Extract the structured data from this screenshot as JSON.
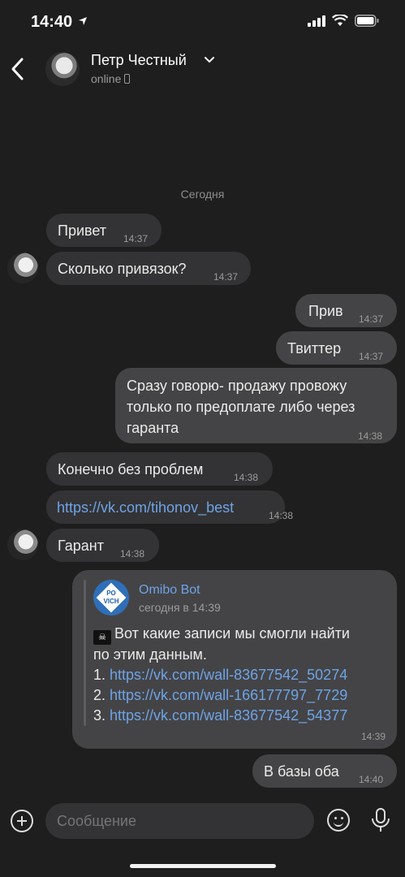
{
  "status_bar": {
    "time": "14:40"
  },
  "header": {
    "name": "Петр Честный",
    "status": "online"
  },
  "date_separator": "Сегодня",
  "messages": [
    {
      "text": "Привет",
      "time": "14:37"
    },
    {
      "text": "Сколько привязок?",
      "time": "14:37"
    },
    {
      "text": "Прив",
      "time": "14:37"
    },
    {
      "text": "Твиттер",
      "time": "14:37"
    },
    {
      "text": "Сразу говорю- продажу провожу",
      "text2": "только по предоплате либо через",
      "text3": "гаранта",
      "time": "14:38"
    },
    {
      "text": "Конечно без проблем",
      "time": "14:38"
    },
    {
      "text": "https://vk.com/tihonov_best",
      "time": "14:38"
    },
    {
      "text": "Гарант",
      "time": "14:38"
    },
    {
      "text": "В базы оба",
      "time": "14:40"
    }
  ],
  "forwarded": {
    "sender": "Omibo Bot",
    "date": "сегодня в 14:39",
    "logo_text": "PO VICH",
    "line1": "Вот какие записи мы смогли найти",
    "line2": "по этим данным.",
    "links": [
      {
        "num": "1.",
        "url": "https://vk.com/wall-83677542_50274"
      },
      {
        "num": "2.",
        "url": "https://vk.com/wall-166177797_7729"
      },
      {
        "num": "3.",
        "url": "https://vk.com/wall-83677542_54377"
      }
    ],
    "time": "14:39"
  },
  "composer": {
    "placeholder": "Сообщение"
  },
  "colors": {
    "background": "#1e1e1f",
    "incoming": "#333335",
    "outgoing": "#444446",
    "link": "#6ea3e6"
  }
}
